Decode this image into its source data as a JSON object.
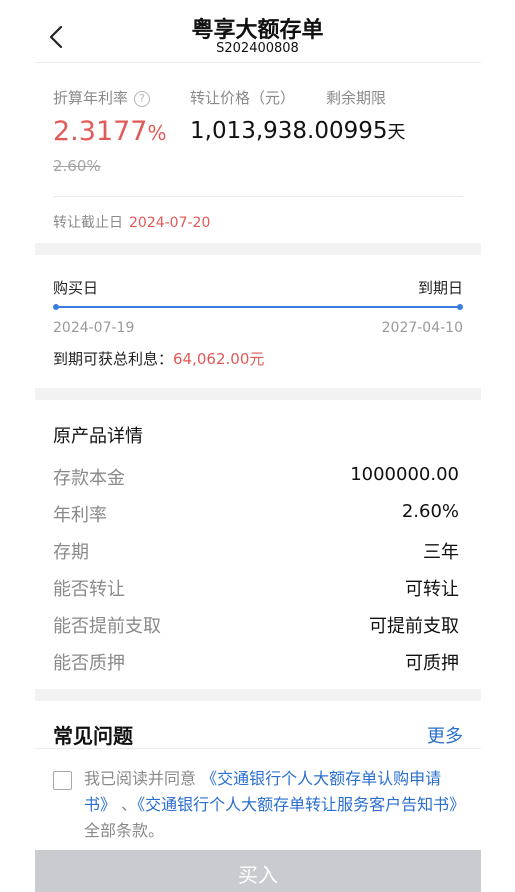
{
  "header": {
    "back_icon": "chevron-left-icon",
    "title": "粤享大额存单",
    "product_code": "S202400808"
  },
  "summary": {
    "rate_label": "折算年利率",
    "help_icon": "question-circle-icon",
    "help_glyph": "?",
    "rate_value": "2.3177",
    "rate_unit": "%",
    "original_rate": "2.60%",
    "price_label": "转让价格（元）",
    "price_value": "1,013,938.00995",
    "remaining_label": "剩余期限",
    "remaining_unit": "天",
    "deadline_label": "转让截止日",
    "deadline_value": "2024-07-20"
  },
  "timeline": {
    "buy_label": "购买日",
    "maturity_label": "到期日",
    "buy_date": "2024-07-19",
    "maturity_date": "2027-04-10",
    "interest_label": "到期可获总利息：",
    "interest_value": "64,062.00元"
  },
  "details": {
    "title": "原产品详情",
    "rows": [
      {
        "key": "存款本金",
        "value": "1000000.00"
      },
      {
        "key": "年利率",
        "value": "2.60%"
      },
      {
        "key": "存期",
        "value": "三年"
      },
      {
        "key": "能否转让",
        "value": "可转让"
      },
      {
        "key": "能否提前支取",
        "value": "可提前支取"
      },
      {
        "key": "能否质押",
        "value": "可质押"
      }
    ]
  },
  "faq": {
    "title": "常见问题",
    "more": "更多"
  },
  "agreement": {
    "prefix": "我已阅读并同意 ",
    "link1": "《交通银行个人大额存单认购申请书》",
    "separator": " 、",
    "link2": "《交通银行个人大额存单转让服务客户告知书》",
    "suffix": " 全部条款。"
  },
  "buy_button": "买入",
  "colors": {
    "accent_red": "#e05a57",
    "link_blue": "#2a6fcf",
    "timeline_blue": "#3a7de0",
    "button_disabled": "#c9cbce"
  }
}
